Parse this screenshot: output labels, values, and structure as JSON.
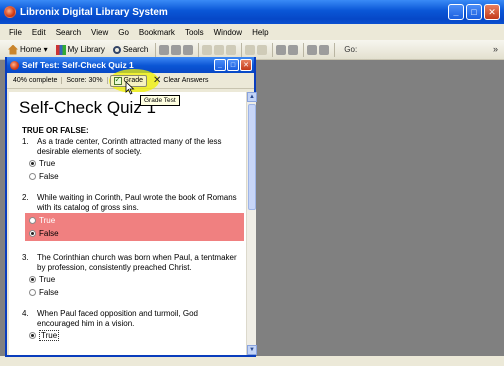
{
  "app": {
    "title": "Libronix Digital Library System",
    "window_buttons": [
      "_",
      "□",
      "✕"
    ]
  },
  "menu": [
    "File",
    "Edit",
    "Search",
    "View",
    "Go",
    "Bookmark",
    "Tools",
    "Window",
    "Help"
  ],
  "toolbar": {
    "home": "Home",
    "library": "My Library",
    "search": "Search",
    "go_label": "Go:",
    "overflow": "»"
  },
  "dialog": {
    "title": "Self Test: Self-Check Quiz 1",
    "percent_complete": "40% complete",
    "score": "Score: 30%",
    "grade_label": "Grade",
    "clear_label": "Clear Answers",
    "tooltip": "Grade Test"
  },
  "quiz": {
    "title": "Self-Check Quiz 1",
    "section": "TRUE OR FALSE:",
    "questions": [
      {
        "num": "1.",
        "text": "As a trade center, Corinth attracted many of the less desirable elements of society.",
        "opt_true": "True",
        "opt_false": "False",
        "selected": "True",
        "wrong": false
      },
      {
        "num": "2.",
        "text": "While waiting in Corinth, Paul wrote the book of Romans with its catalog of gross sins.",
        "opt_true": "True",
        "opt_false": "False",
        "selected": "False",
        "wrong": true
      },
      {
        "num": "3.",
        "text": "The Corinthian church was born when Paul, a tentmaker by profession, consistently preached Christ.",
        "opt_true": "True",
        "opt_false": "False",
        "selected": "True",
        "wrong": false
      },
      {
        "num": "4.",
        "text": "When Paul faced opposition and turmoil, God encouraged him in a vision.",
        "opt_true": "True",
        "selected": "True",
        "wrong": false
      }
    ]
  },
  "colors": {
    "titlebar": "#0a56d6",
    "workspace": "#808080",
    "wrong_answer": "#f08080",
    "highlight": "#f0f000"
  }
}
